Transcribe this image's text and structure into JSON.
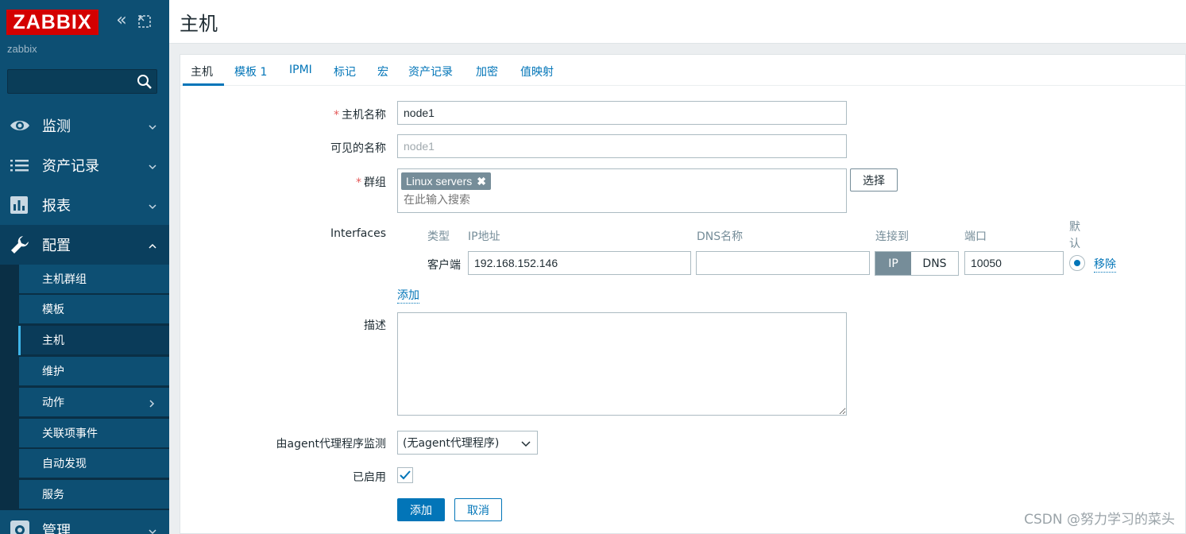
{
  "app": {
    "logo": "ZABBIX",
    "server_name": "zabbix",
    "collapse_icon": "double-chevron-left-icon",
    "kiosk_icon": "expand-icon"
  },
  "sidebar": {
    "search_placeholder": "",
    "menu": [
      {
        "label": "监测",
        "icon": "eye-icon",
        "expanded": false
      },
      {
        "label": "资产记录",
        "icon": "list-icon",
        "expanded": false
      },
      {
        "label": "报表",
        "icon": "bar-chart-icon",
        "expanded": false
      },
      {
        "label": "配置",
        "icon": "wrench-icon",
        "expanded": true
      },
      {
        "label": "管理",
        "icon": "gear-icon",
        "expanded": false
      }
    ],
    "submenu": [
      {
        "label": "主机群组"
      },
      {
        "label": "模板"
      },
      {
        "label": "主机",
        "selected": true
      },
      {
        "label": "维护"
      },
      {
        "label": "动作",
        "has_children": true
      },
      {
        "label": "关联项事件"
      },
      {
        "label": "自动发现"
      },
      {
        "label": "服务"
      }
    ]
  },
  "header": {
    "title": "主机"
  },
  "tabs": [
    {
      "label": "主机",
      "active": true
    },
    {
      "label": "模板 1"
    },
    {
      "label": "IPMI"
    },
    {
      "label": "标记"
    },
    {
      "label": "宏"
    },
    {
      "label": "资产记录"
    },
    {
      "label": "加密"
    },
    {
      "label": "值映射"
    }
  ],
  "form": {
    "host_name": {
      "label": "主机名称",
      "required": true,
      "value": "node1"
    },
    "visible_name": {
      "label": "可见的名称",
      "placeholder": "node1"
    },
    "groups": {
      "label": "群组",
      "required": true,
      "chips": [
        "Linux servers"
      ],
      "search_placeholder": "在此输入搜索",
      "select_button": "选择"
    },
    "interfaces": {
      "label": "Interfaces",
      "columns": {
        "type": "类型",
        "ip": "IP地址",
        "dns": "DNS名称",
        "connect": "连接到",
        "port": "端口",
        "default_line1": "默",
        "default_line2": "认"
      },
      "row": {
        "type": "客户端",
        "ip": "192.168.152.146",
        "dns": "",
        "connect_ip": "IP",
        "connect_dns": "DNS",
        "connect_selected": "IP",
        "port": "10050",
        "default": true,
        "remove": "移除"
      },
      "add": "添加"
    },
    "description": {
      "label": "描述",
      "value": ""
    },
    "proxy": {
      "label": "由agent代理程序监测",
      "value": "(无agent代理程序)"
    },
    "enabled": {
      "label": "已启用",
      "checked": true
    },
    "submit": "添加",
    "cancel": "取消"
  },
  "watermark": "CSDN @努力学习的菜头",
  "colors": {
    "sidebar": "#0d4f73",
    "logo": "#d40000",
    "accent": "#0275b8",
    "required": "#e45959"
  }
}
